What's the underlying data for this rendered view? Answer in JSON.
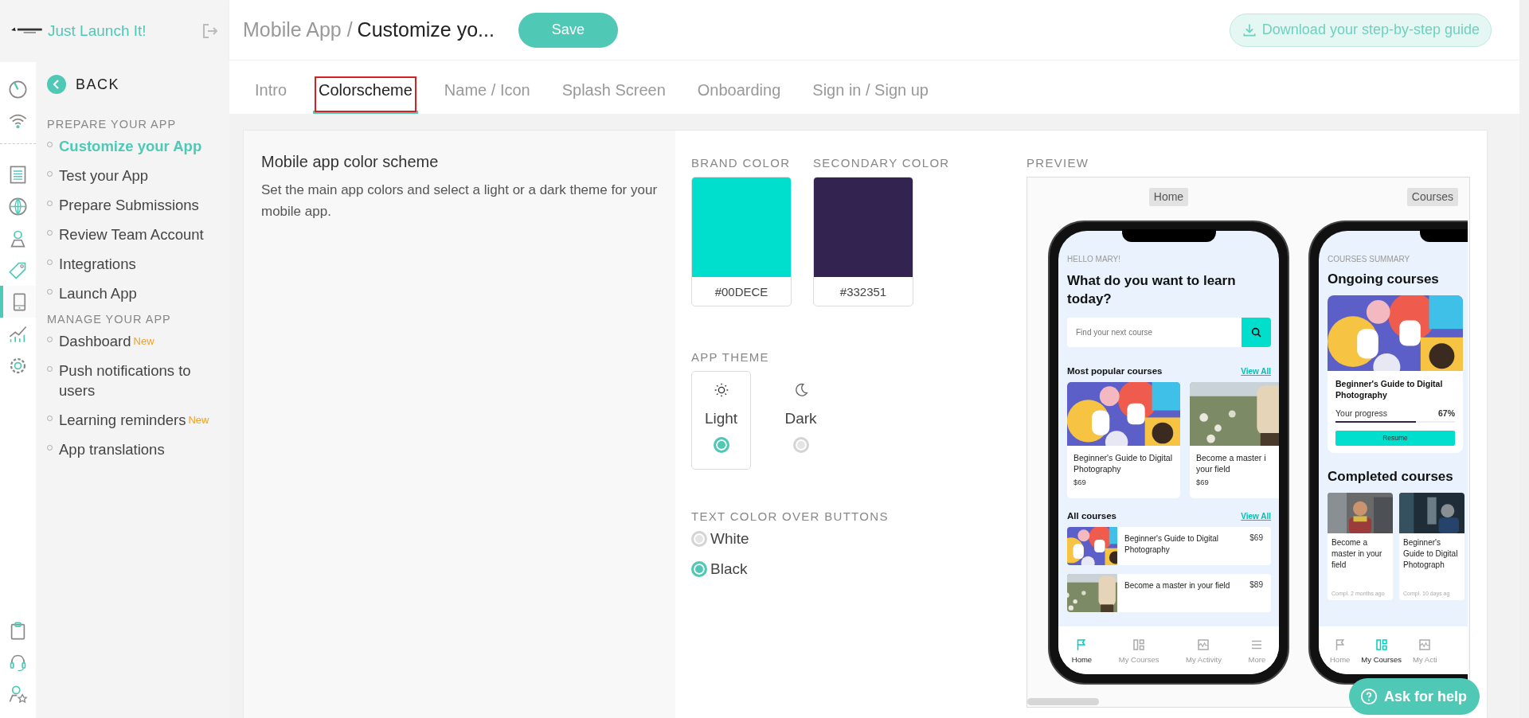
{
  "brand": {
    "name": "Just Launch It!"
  },
  "rail": {
    "top": [
      {
        "selected": false
      },
      {
        "selected": false
      }
    ],
    "main": [
      {
        "selected": false
      },
      {
        "selected": false
      },
      {
        "selected": false
      },
      {
        "selected": false
      },
      {
        "selected": true
      },
      {
        "selected": false
      },
      {
        "selected": false
      }
    ],
    "bottom": [
      {
        "selected": false
      },
      {
        "selected": false
      },
      {
        "selected": false
      }
    ]
  },
  "sidebar": {
    "back": "BACK",
    "sections": [
      {
        "title": "PREPARE YOUR APP",
        "items": [
          {
            "label": "Customize your App",
            "selected": true
          },
          {
            "label": "Test your App",
            "selected": false
          },
          {
            "label": "Prepare Submissions",
            "selected": false
          },
          {
            "label": "Review Team Account",
            "selected": false
          },
          {
            "label": "Integrations",
            "selected": false
          },
          {
            "label": "Launch App",
            "selected": false
          }
        ]
      },
      {
        "title": "MANAGE YOUR APP",
        "items": [
          {
            "label": "Dashboard",
            "badge": "New",
            "selected": false
          },
          {
            "label": "Push notifications to users",
            "selected": false
          },
          {
            "label": "Learning reminders",
            "badge": "New",
            "selected": false
          },
          {
            "label": "App translations",
            "selected": false
          }
        ]
      }
    ]
  },
  "header": {
    "parent": "Mobile App /",
    "current": "Customize yo...",
    "save": "Save",
    "download": "Download your step-by-step guide"
  },
  "tabs": [
    {
      "label": "Intro",
      "selected": false,
      "outlined": false
    },
    {
      "label": "Colorscheme",
      "selected": true,
      "outlined": true
    },
    {
      "label": "Name / Icon",
      "selected": false,
      "outlined": false
    },
    {
      "label": "Splash Screen",
      "selected": false,
      "outlined": false
    },
    {
      "label": "Onboarding",
      "selected": false,
      "outlined": false
    },
    {
      "label": "Sign in / Sign up",
      "selected": false,
      "outlined": false
    }
  ],
  "intro": {
    "title": "Mobile app color scheme",
    "description": "Set the main app colors and select a light or a dark theme for your mobile app."
  },
  "colors": [
    {
      "label": "BRAND COLOR",
      "value": "#00DECE",
      "color": "#00dece"
    },
    {
      "label": "SECONDARY COLOR",
      "value": "#332351",
      "color": "#332351"
    }
  ],
  "app_theme": {
    "label": "APP THEME",
    "options": [
      {
        "label": "Light",
        "selected": true
      },
      {
        "label": "Dark",
        "selected": false
      }
    ]
  },
  "button_text_color": {
    "label": "TEXT COLOR OVER BUTTONS",
    "options": [
      {
        "label": "White",
        "selected": false
      },
      {
        "label": "Black",
        "selected": true
      }
    ]
  },
  "preview": {
    "label": "PREVIEW",
    "home": {
      "tag": "Home",
      "greeting": "HELLO MARY!",
      "heading": "What do you want to learn today?",
      "search_placeholder": "Find your next course",
      "popular": {
        "title": "Most popular courses",
        "link": "View All",
        "cards": [
          {
            "title": "Beginner's Guide to Digital Photography",
            "price": "$69"
          },
          {
            "title": "Become a master i\nyour field",
            "price": "$69"
          }
        ]
      },
      "all": {
        "title": "All courses",
        "link": "View All",
        "rows": [
          {
            "title": "Beginner's Guide to Digital Photography",
            "price": "$69"
          },
          {
            "title": "Become a master in your field",
            "price": "$89"
          }
        ]
      },
      "nav": [
        {
          "label": "Home",
          "selected": true
        },
        {
          "label": "My Courses",
          "selected": false
        },
        {
          "label": "My Activity",
          "selected": false
        },
        {
          "label": "More",
          "selected": false
        }
      ]
    },
    "courses": {
      "tag": "Courses",
      "summary": "COURSES SUMMARY",
      "heading": "Ongoing courses",
      "ongoing": {
        "title": "Beginner's Guide to Digital Photography",
        "progress_label": "Your progress",
        "progress_value": "67%",
        "level": 0.67,
        "button": "Resume"
      },
      "completed_title": "Completed courses",
      "completed": [
        {
          "title": "Become a master in your field",
          "meta": "Compl. 2 months ago"
        },
        {
          "title": "Beginner's Guide to Digital Photograph",
          "meta": "Compl. 10 days ag"
        }
      ],
      "nav": [
        {
          "label": "Home",
          "selected": false
        },
        {
          "label": "My Courses",
          "selected": true
        },
        {
          "label": "My Acti",
          "selected": false
        }
      ]
    }
  },
  "help": {
    "label": "Ask for help"
  }
}
